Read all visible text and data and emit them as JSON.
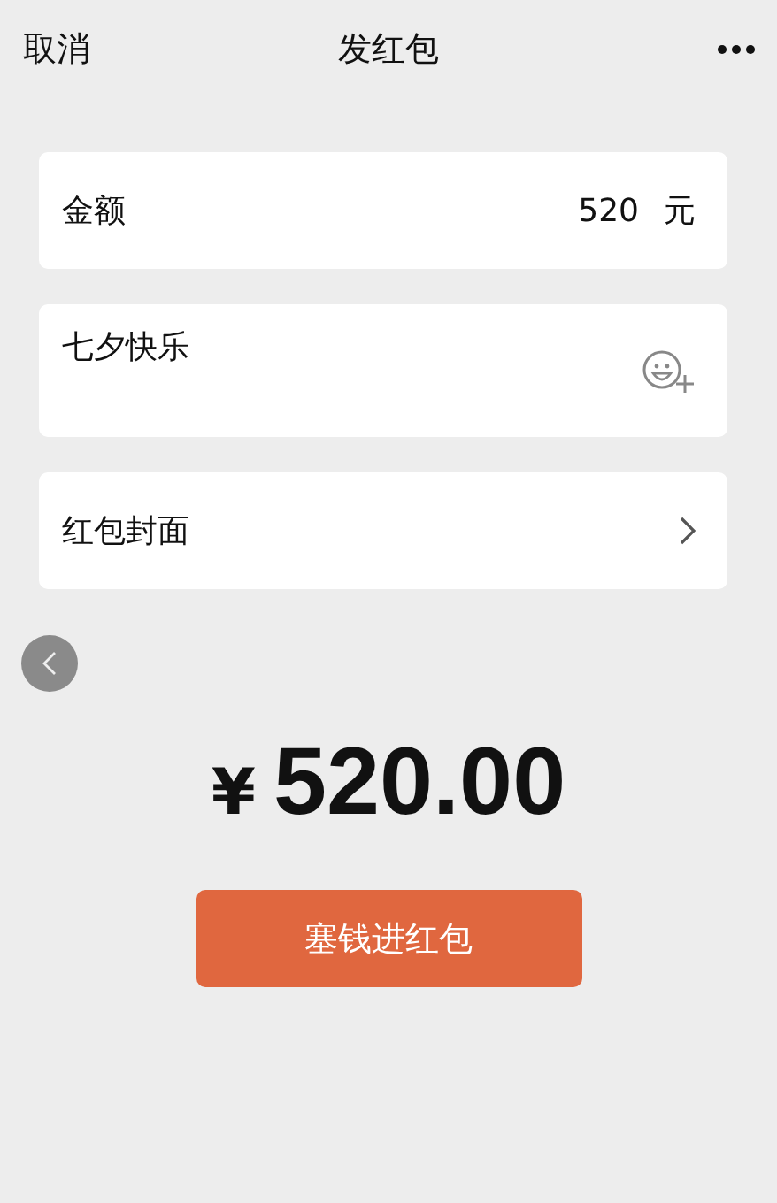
{
  "header": {
    "cancel": "取消",
    "title": "发红包"
  },
  "amount_row": {
    "label": "金额",
    "value": "520",
    "unit": "元"
  },
  "greeting": {
    "value": "七夕快乐"
  },
  "cover_row": {
    "label": "红包封面"
  },
  "total": {
    "currency": "¥",
    "amount": "520.00"
  },
  "submit": "塞钱进红包"
}
